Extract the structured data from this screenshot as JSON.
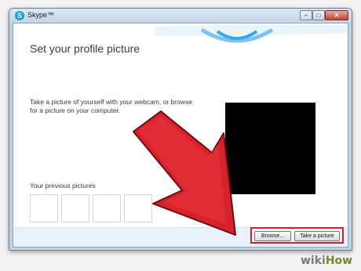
{
  "window": {
    "title": "Skype™",
    "icon": "skype-icon",
    "controls": {
      "minimize": "–",
      "maximize": "□",
      "close": "✕"
    }
  },
  "main": {
    "title": "Set your profile picture",
    "description": "Take a picture of yourself with your webcam, or browse for a picture on your computer.",
    "previous_label": "Your previous pictures",
    "previous_count": 4
  },
  "actions": {
    "browse_label": "Browse...",
    "take_label": "Take a picture"
  },
  "watermark": {
    "part1": "wiki",
    "part2": "How"
  },
  "colors": {
    "highlight": "#d21f2b",
    "arrow": "#d7222c",
    "skype_blue": "#1a9ee0"
  }
}
